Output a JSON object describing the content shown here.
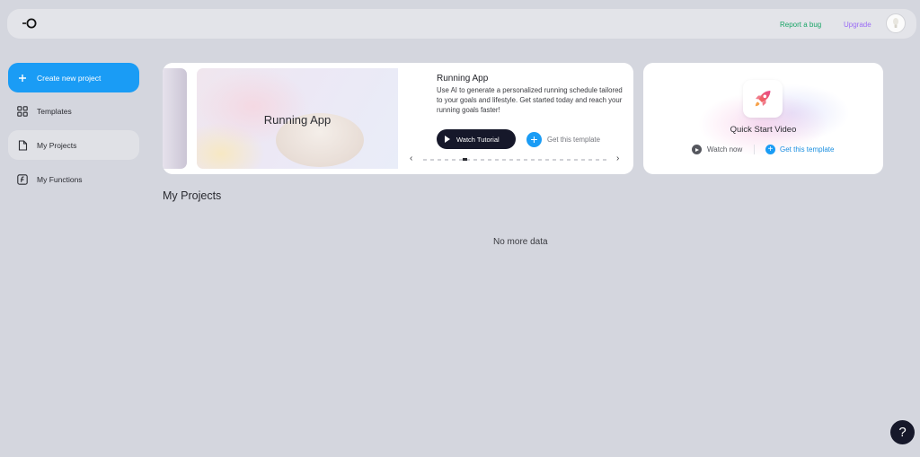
{
  "header": {
    "logo_icon": "logo-icon",
    "report_bug_label": "Report a bug",
    "upgrade_label": "Upgrade",
    "avatar_icon": "avatar-icon",
    "colors": {
      "report_bug": "#1aa567",
      "upgrade": "#9b6cf5"
    }
  },
  "sidebar": {
    "items": [
      {
        "label": "Create new project",
        "icon": "plus-icon",
        "active": false,
        "primary": true
      },
      {
        "label": "Templates",
        "icon": "grid-icon",
        "active": false
      },
      {
        "label": "My Projects",
        "icon": "file-icon",
        "active": true
      },
      {
        "label": "My Functions",
        "icon": "function-icon",
        "active": false
      }
    ],
    "accent": "#1a9cf5"
  },
  "banner": {
    "slide_title": "Running App",
    "template_title": "Running App",
    "template_description": "Use AI to generate a personalized running schedule tailored to your goals and lifestyle. Get started today and reach your running goals faster!",
    "watch_tutorial_label": "Watch Tutorial",
    "get_template_label": "Get this template",
    "prev_icon": "chevron-left-icon",
    "next_icon": "chevron-right-icon"
  },
  "quick_start": {
    "title": "Quick Start Video",
    "icon": "rocket-icon",
    "watch_now_label": "Watch now",
    "get_template_label": "Get this template"
  },
  "main": {
    "section_title": "My Projects",
    "empty_text": "No more data"
  },
  "help": {
    "label": "?",
    "icon": "help-icon"
  }
}
